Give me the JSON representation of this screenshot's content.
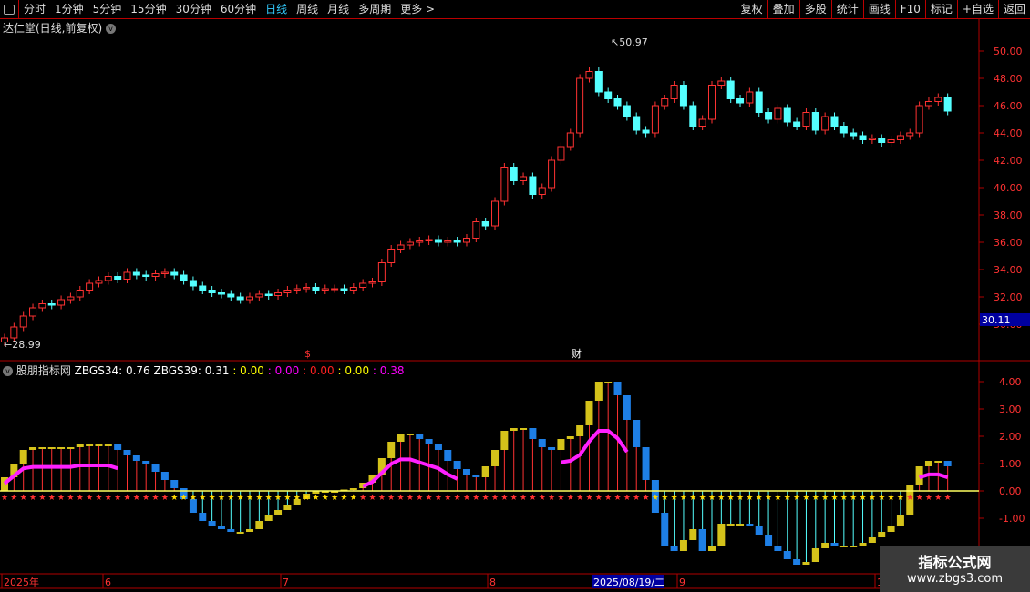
{
  "toolbar": {
    "periods": [
      "分时",
      "1分钟",
      "5分钟",
      "15分钟",
      "30分钟",
      "60分钟",
      "日线",
      "周线",
      "月线",
      "多周期",
      "更多 >"
    ],
    "active": "日线",
    "right": [
      "复权",
      "叠加",
      "多股",
      "统计",
      "画线",
      "F10",
      "标记",
      "+自选",
      "返回"
    ]
  },
  "title": "达仁堂(日线,前复权)",
  "indicator": {
    "name": "股朋指标网",
    "items": [
      {
        "t": "ZBGS34: 0.76",
        "c": "#ffffff"
      },
      {
        "t": "ZBGS39: 0.31",
        "c": "#ffffff"
      },
      {
        "t": ": 0.00",
        "c": "#ffff00"
      },
      {
        "t": ": 0.00",
        "c": "#ff00ff"
      },
      {
        "t": ": 0.00",
        "c": "#ff2020"
      },
      {
        "t": ": 0.00",
        "c": "#ffff00"
      },
      {
        "t": ": 0.38",
        "c": "#ff00ff"
      }
    ]
  },
  "chart_data": [
    {
      "type": "candlestick",
      "yticks": [
        "50.00",
        "48.00",
        "46.00",
        "44.00",
        "42.00",
        "40.00",
        "38.00",
        "36.00",
        "34.00",
        "32.00",
        "30.00"
      ],
      "ylim": [
        29,
        51
      ],
      "high_label": "50.97",
      "low_label": "28.99",
      "current_price": "30.11",
      "markers": [
        "$",
        "财"
      ],
      "closes": [
        29.0,
        29.8,
        30.6,
        31.2,
        31.5,
        31.4,
        31.8,
        32.0,
        32.5,
        33.0,
        33.2,
        33.5,
        33.3,
        33.8,
        33.6,
        33.5,
        33.7,
        33.8,
        33.6,
        33.2,
        32.8,
        32.5,
        32.3,
        32.2,
        32.0,
        31.8,
        32.0,
        32.2,
        32.1,
        32.3,
        32.5,
        32.6,
        32.7,
        32.5,
        32.6,
        32.6,
        32.5,
        32.7,
        33.0,
        33.1,
        34.5,
        35.5,
        35.8,
        36.0,
        36.1,
        36.2,
        36.0,
        36.1,
        36.0,
        36.3,
        37.5,
        37.2,
        39.0,
        41.5,
        40.5,
        40.8,
        39.5,
        40.0,
        42.0,
        43.0,
        44.0,
        48.0,
        48.5,
        47.0,
        46.5,
        46.0,
        45.2,
        44.2,
        44.0,
        46.0,
        46.5,
        47.5,
        46.0,
        44.5,
        45.0,
        47.5,
        47.8,
        46.5,
        46.2,
        47.0,
        45.5,
        45.0,
        45.8,
        44.8,
        44.5,
        45.5,
        44.2,
        45.2,
        44.5,
        44.0,
        43.8,
        43.5,
        43.6,
        43.3,
        43.5,
        43.8,
        44.0,
        46.0,
        46.3,
        46.6,
        45.6
      ]
    },
    {
      "type": "bar",
      "yticks": [
        "4.00",
        "3.00",
        "2.00",
        "1.00",
        "0.00",
        "-1.00"
      ],
      "ylim": [
        -2.9,
        4.3
      ],
      "values": [
        0.5,
        1.0,
        1.5,
        1.6,
        1.6,
        1.6,
        1.6,
        1.6,
        1.7,
        1.7,
        1.7,
        1.7,
        1.5,
        1.3,
        1.1,
        1.0,
        0.7,
        0.4,
        0.1,
        -0.3,
        -0.8,
        -1.1,
        -1.3,
        -1.4,
        -1.5,
        -1.5,
        -1.4,
        -1.1,
        -0.9,
        -0.7,
        -0.5,
        -0.3,
        -0.1,
        0,
        0,
        0,
        0.05,
        0.1,
        0.3,
        0.6,
        1.2,
        1.8,
        2.1,
        2.1,
        1.9,
        1.7,
        1.5,
        1.1,
        0.8,
        0.6,
        0.5,
        0.9,
        1.5,
        2.2,
        2.3,
        2.3,
        1.9,
        1.6,
        1.5,
        1.9,
        2.0,
        2.4,
        3.3,
        4.0,
        4.0,
        3.5,
        2.6,
        1.6,
        0.4,
        -0.8,
        -2.0,
        -2.2,
        -1.8,
        -1.4,
        -2.2,
        -2.0,
        -1.2,
        -1.2,
        -1.2,
        -1.3,
        -1.6,
        -2.0,
        -2.2,
        -2.5,
        -2.7,
        -2.6,
        -2.1,
        -1.9,
        -2.0,
        -2.0,
        -2.0,
        -1.9,
        -1.7,
        -1.5,
        -1.3,
        -0.9,
        0.2,
        0.9,
        1.1,
        1.1,
        0.9
      ]
    },
    {
      "type": "axis",
      "xlabels": [
        "2025年",
        "6",
        "7",
        "8",
        "9",
        "10"
      ],
      "cursor_date": "2025/08/19/二"
    }
  ],
  "watermark": {
    "line1": "指标公式网",
    "line2": "www.zbgs3.com"
  },
  "colors": {
    "up": "#ff3232",
    "down": "#54ffff",
    "border": "#b00000",
    "barUp": "#d4c21a",
    "barDown": "#1e7fe6"
  }
}
